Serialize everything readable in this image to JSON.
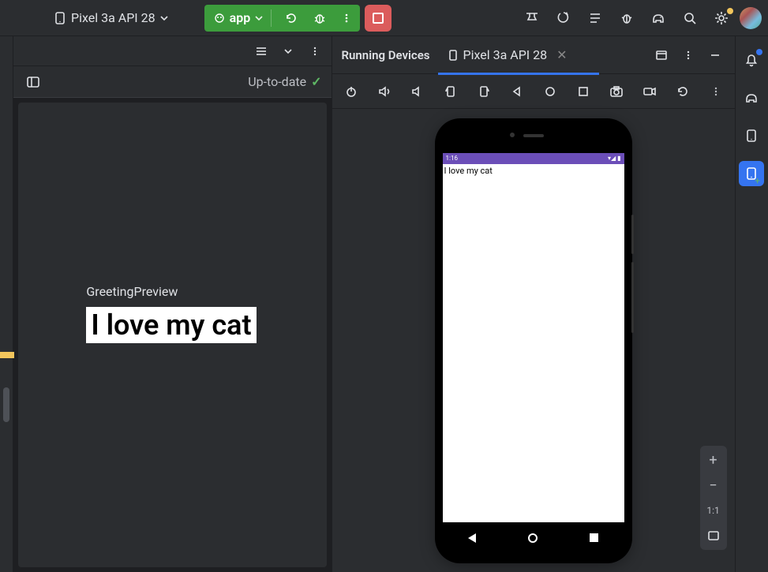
{
  "toolbar": {
    "device_selector_label": "Pixel 3a API 28",
    "run_config_label": "app"
  },
  "preview": {
    "status": "Up-to-date",
    "component_name": "GreetingPreview",
    "render_text": "I love my cat"
  },
  "running_devices": {
    "panel_title": "Running Devices",
    "active_tab_label": "Pixel 3a API 28"
  },
  "emulator": {
    "status_time": "1:16",
    "app_screen_text": "I love my cat"
  },
  "zoom": {
    "one_to_one": "1:1"
  }
}
